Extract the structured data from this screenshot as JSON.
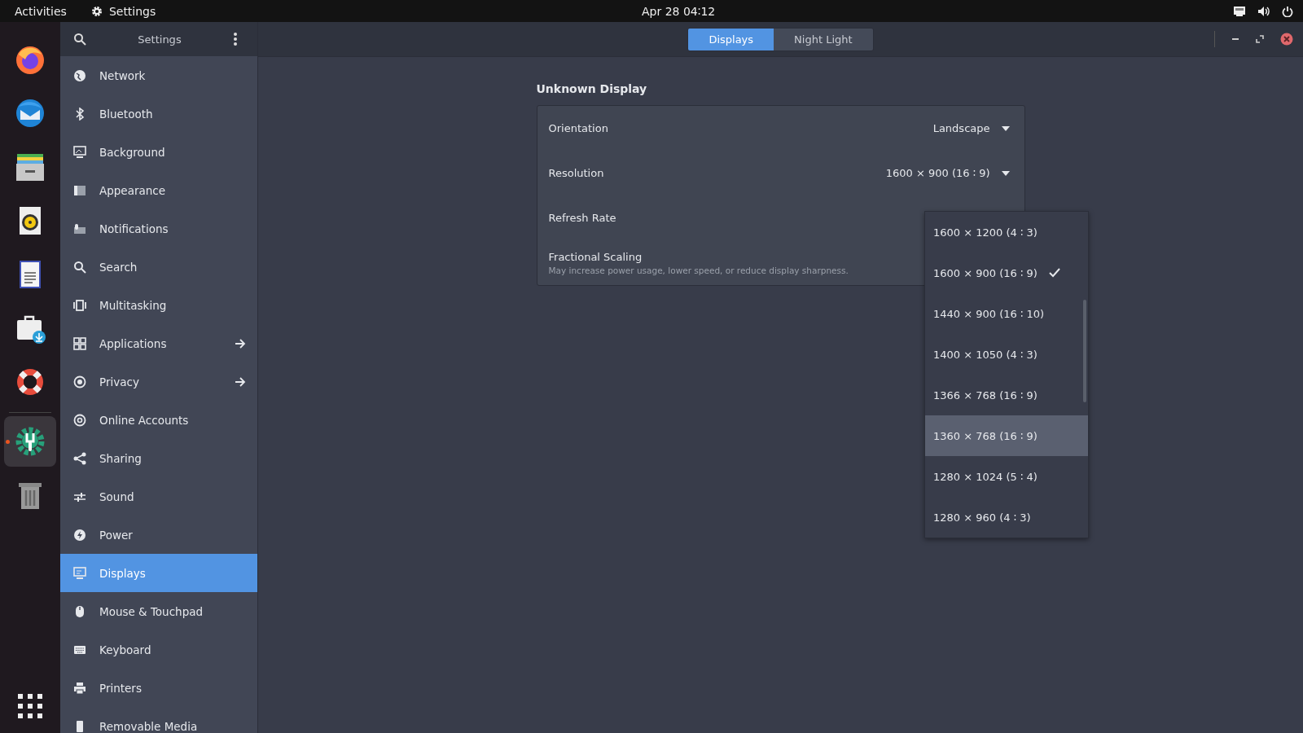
{
  "top_bar": {
    "activities": "Activities",
    "app_name": "Settings",
    "clock": "Apr 28  04∶12"
  },
  "dock": {
    "apps": [
      {
        "active": false
      },
      {
        "active": false
      },
      {
        "active": false
      },
      {
        "active": false
      },
      {
        "active": false
      },
      {
        "active": false
      },
      {
        "active": false
      },
      {
        "active": true
      },
      {
        "active": false
      }
    ]
  },
  "sidebar": {
    "title": "Settings",
    "items": [
      {
        "label": "Network",
        "selected": false,
        "submenu": false
      },
      {
        "label": "Bluetooth",
        "selected": false,
        "submenu": false
      },
      {
        "label": "Background",
        "selected": false,
        "submenu": false
      },
      {
        "label": "Appearance",
        "selected": false,
        "submenu": false
      },
      {
        "label": "Notifications",
        "selected": false,
        "submenu": false
      },
      {
        "label": "Search",
        "selected": false,
        "submenu": false
      },
      {
        "label": "Multitasking",
        "selected": false,
        "submenu": false
      },
      {
        "label": "Applications",
        "selected": false,
        "submenu": true
      },
      {
        "label": "Privacy",
        "selected": false,
        "submenu": true
      },
      {
        "label": "Online Accounts",
        "selected": false,
        "submenu": false
      },
      {
        "label": "Sharing",
        "selected": false,
        "submenu": false
      },
      {
        "label": "Sound",
        "selected": false,
        "submenu": false
      },
      {
        "label": "Power",
        "selected": false,
        "submenu": false
      },
      {
        "label": "Displays",
        "selected": true,
        "submenu": false
      },
      {
        "label": "Mouse & Touchpad",
        "selected": false,
        "submenu": false
      },
      {
        "label": "Keyboard",
        "selected": false,
        "submenu": false
      },
      {
        "label": "Printers",
        "selected": false,
        "submenu": false
      },
      {
        "label": "Removable Media",
        "selected": false,
        "submenu": false
      }
    ]
  },
  "tabs": [
    {
      "label": "Displays",
      "selected": true
    },
    {
      "label": "Night Light",
      "selected": false
    }
  ],
  "display": {
    "title": "Unknown Display",
    "rows": [
      {
        "label": "Orientation",
        "value": "Landscape"
      },
      {
        "label": "Resolution",
        "value": "1600 × 900 (16 ∶ 9)"
      },
      {
        "label": "Refresh Rate"
      },
      {
        "label": "Fractional Scaling",
        "description": "May increase power usage, lower speed, or reduce display sharpness."
      }
    ]
  },
  "resolution_menu": {
    "options": [
      {
        "label": "1600 × 1200 (4 ∶ 3)",
        "selected": false,
        "highlighted": false
      },
      {
        "label": "1600 × 900 (16 ∶ 9)",
        "selected": true,
        "highlighted": false
      },
      {
        "label": "1440 × 900 (16 ∶ 10)",
        "selected": false,
        "highlighted": false
      },
      {
        "label": "1400 × 1050 (4 ∶ 3)",
        "selected": false,
        "highlighted": false
      },
      {
        "label": "1366 × 768 (16 ∶ 9)",
        "selected": false,
        "highlighted": false
      },
      {
        "label": "1360 × 768 (16 ∶ 9)",
        "selected": false,
        "highlighted": true
      },
      {
        "label": "1280 × 1024 (5 ∶ 4)",
        "selected": false,
        "highlighted": false
      },
      {
        "label": "1280 × 960 (4 ∶ 3)",
        "selected": false,
        "highlighted": false
      }
    ]
  }
}
